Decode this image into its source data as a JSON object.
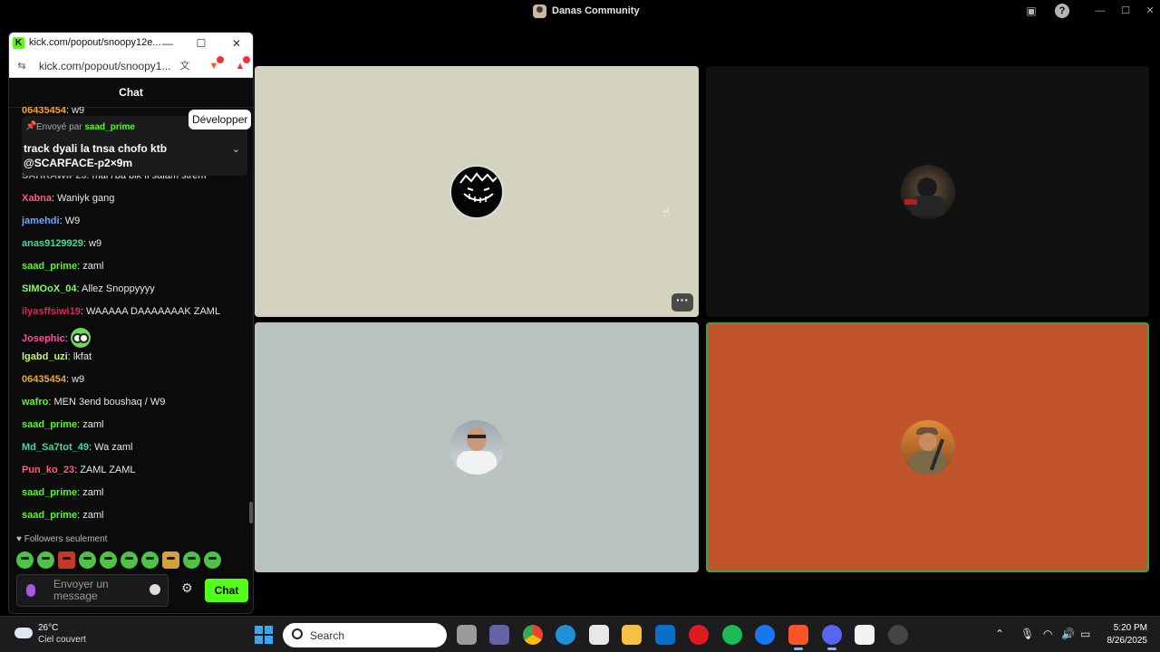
{
  "window": {
    "title": "Danas Community"
  },
  "popout": {
    "tab_title": "kick.com/popout/snoopy12e...",
    "url": "kick.com/popout/snoopy1...",
    "chat_header": "Chat",
    "tooltip": "Développer",
    "pinned": {
      "sent_by_label": "Envoyé par",
      "sent_by_user": "saad_prime",
      "text": "track dyali la tnsa chofo ktb @SCARFACE-p2×9m"
    },
    "messages": [
      {
        "user": "06435454",
        "text": ": w9",
        "color": "#f5a623"
      },
      {
        "user": "SAHRAWIP23",
        "text": ": mar7ba bik fi salam strem",
        "color": "#9aa0a6"
      },
      {
        "user": "Xabna",
        "text": ": Waniyk gang",
        "color": "#ff5c7a"
      },
      {
        "user": "jamehdi",
        "text": ": W9",
        "color": "#6aa8ff"
      },
      {
        "user": "anas9129929",
        "text": ": w9",
        "color": "#3ddc97"
      },
      {
        "user": "saad_prime",
        "text": ": zaml",
        "color": "#53fc18"
      },
      {
        "user": "SIMOoX_04",
        "text": ": Allez Snoppyyyy",
        "color": "#7dff5a"
      },
      {
        "user": "ilyasffsiwi19",
        "text": ": WAAAAA DAAAAAAAK ZAML",
        "color": "#e0245e"
      },
      {
        "user": "Josephic",
        "text": ": ",
        "color": "#ff4fa3",
        "emote": true
      },
      {
        "user": "lgabd_uzi",
        "text": ": lkfat",
        "color": "#c8f56a"
      },
      {
        "user": "06435454",
        "text": ": w9",
        "color": "#f5a623"
      },
      {
        "user": "wafro",
        "text": ": MEN 3end boushaq / W9",
        "color": "#53fc18"
      },
      {
        "user": "saad_prime",
        "text": ": zaml",
        "color": "#53fc18"
      },
      {
        "user": "Md_Sa7tot_49",
        "text": ": Wa zaml",
        "color": "#3ddc97"
      },
      {
        "user": "Pun_ko_23",
        "text": ": ZAML ZAML",
        "color": "#ff5c7a"
      },
      {
        "user": "saad_prime",
        "text": ": zaml",
        "color": "#53fc18"
      },
      {
        "user": "saad_prime",
        "text": ": zaml",
        "color": "#53fc18"
      }
    ],
    "followers_only": "Followers seulement",
    "input_placeholder": "Envoyer un message",
    "send_label": "Chat"
  },
  "taskbar": {
    "temperature": "26°C",
    "condition": "Ciel couvert",
    "search_label": "Search",
    "time": "5:20 PM",
    "date": "8/26/2025"
  },
  "colors": {
    "kick_green": "#53fc18",
    "tile_orange": "#c0552c",
    "speaking_border": "#3ea04a"
  }
}
